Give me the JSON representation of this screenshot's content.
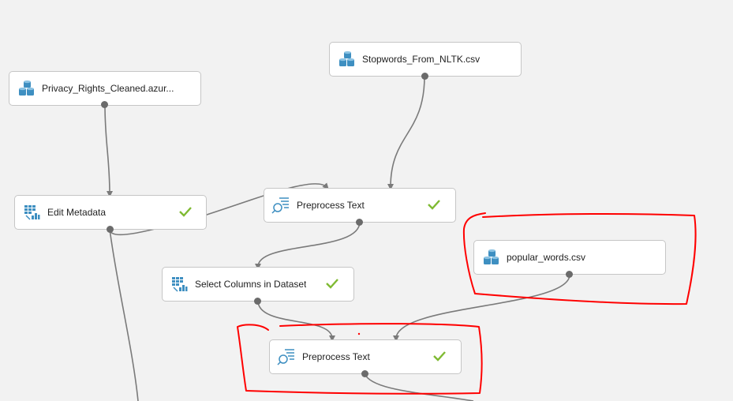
{
  "colors": {
    "canvas_bg": "#f2f2f2",
    "module_bg": "#ffffff",
    "module_border": "#c6c6c6",
    "connector": "#7a7a7a",
    "port": "#6b6b6b",
    "icon_blue": "#3e8fc1",
    "check_green": "#7fba32",
    "annotation_red": "#ff0000"
  },
  "modules": {
    "privacy_rights": {
      "label": "Privacy_Rights_Cleaned.azur...",
      "icon": "dataset-cylinders-icon",
      "status": ""
    },
    "stopwords": {
      "label": "Stopwords_From_NLTK.csv",
      "icon": "dataset-cylinders-icon",
      "status": ""
    },
    "edit_metadata": {
      "label": "Edit Metadata",
      "icon": "edit-metadata-icon",
      "status": "completed"
    },
    "preprocess_text_1": {
      "label": "Preprocess Text",
      "icon": "preprocess-text-icon",
      "status": "completed"
    },
    "popular_words": {
      "label": "popular_words.csv",
      "icon": "dataset-cylinders-icon",
      "status": ""
    },
    "select_columns": {
      "label": "Select Columns in Dataset",
      "icon": "select-columns-icon",
      "status": "completed"
    },
    "preprocess_text_2": {
      "label": "Preprocess Text",
      "icon": "preprocess-text-icon",
      "status": "completed"
    }
  }
}
